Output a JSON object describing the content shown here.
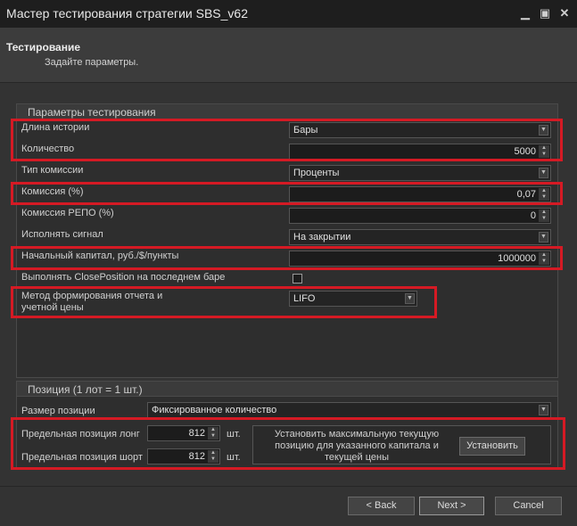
{
  "window": {
    "title": "Мастер тестирования стратегии SBS_v62"
  },
  "header": {
    "title": "Тестирование",
    "subtitle": "Задайте параметры."
  },
  "test_params": {
    "group_title": "Параметры тестирования",
    "history_length": {
      "label": "Длина истории",
      "value": "Бары"
    },
    "count": {
      "label": "Количество",
      "value": "5000"
    },
    "commission_type": {
      "label": "Тип комиссии",
      "value": "Проценты"
    },
    "commission": {
      "label": "Комиссия (%)",
      "value": "0,07"
    },
    "repo_commission": {
      "label": "Комиссия РЕПО (%)",
      "value": "0"
    },
    "execute_signal": {
      "label": "Исполнять сигнал",
      "value": "На закрытии"
    },
    "initial_capital": {
      "label": "Начальный капитал, руб./$/пункты",
      "value": "1000000"
    },
    "close_position": {
      "label": "Выполнять ClosePosition на последнем баре",
      "checked": false
    },
    "report_method": {
      "label_line1": "Метод формирования отчета и",
      "label_line2": "учетной цены",
      "value": "LIFO"
    }
  },
  "position": {
    "group_title": "Позиция (1 лот = 1 шт.)",
    "size": {
      "label": "Размер позиции",
      "value": "Фиксированное количество"
    },
    "limit_long": {
      "label": "Предельная позиция лонг",
      "value": "812",
      "unit": "шт."
    },
    "limit_short": {
      "label": "Предельная позиция шорт",
      "value": "812",
      "unit": "шт."
    },
    "set_max": {
      "text_line1": "Установить максимальную текущую",
      "text_line2": "позицию для указанного капитала и",
      "text_line3": "текущей цены",
      "button": "Установить"
    }
  },
  "footer": {
    "back": "< Back",
    "next": "Next >",
    "cancel": "Cancel"
  },
  "colors": {
    "highlight": "#d51a24",
    "background": "#333333",
    "titlebar": "#1e1e1e"
  }
}
